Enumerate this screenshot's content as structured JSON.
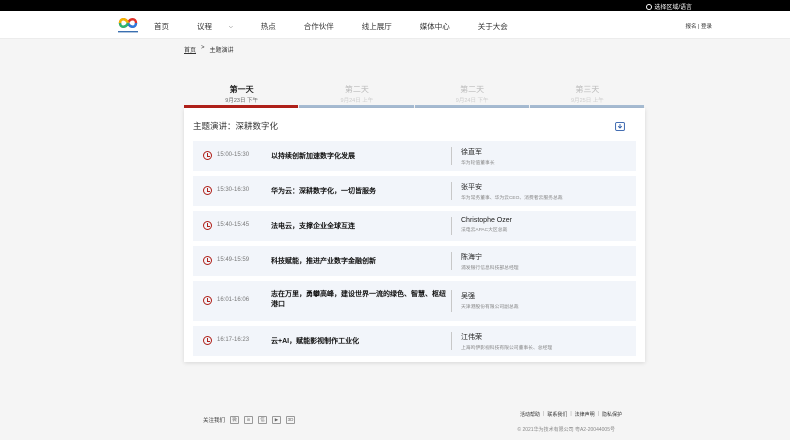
{
  "topbar": {
    "region_label": "选择区域/语言"
  },
  "header": {
    "nav": [
      {
        "label": "首页",
        "dropdown": false
      },
      {
        "label": "议程",
        "dropdown": true
      },
      {
        "label": "热点",
        "dropdown": false
      },
      {
        "label": "合作伙伴",
        "dropdown": false
      },
      {
        "label": "线上展厅",
        "dropdown": false
      },
      {
        "label": "媒体中心",
        "dropdown": false
      },
      {
        "label": "关于大会",
        "dropdown": false
      }
    ],
    "register": "报名",
    "login": "登录",
    "separator": "|"
  },
  "breadcrumb": {
    "home": "首页",
    "sep": ">",
    "current": "主题演讲"
  },
  "days": [
    {
      "name": "第一天",
      "date": "9月23日 下午",
      "active": true
    },
    {
      "name": "第二天",
      "date": "9月24日 上午",
      "active": false
    },
    {
      "name": "第二天",
      "date": "9月24日 下午",
      "active": false
    },
    {
      "name": "第三天",
      "date": "9月25日 上午",
      "active": false
    }
  ],
  "card": {
    "title": "主题演讲：深耕数字化",
    "sessions": [
      {
        "time": "15:00-15:30",
        "title": "以持续创新加速数字化发展",
        "speaker": "徐直军",
        "role": "华为轮值董事长",
        "tall": false
      },
      {
        "time": "15:30-16:30",
        "title": "华为云：深耕数字化，一切皆服务",
        "speaker": "张平安",
        "role": "华为常务董事、华为云CEO、消费者云服务总裁",
        "tall": false
      },
      {
        "time": "15:40-15:45",
        "title": "法电云，支撑企业全球互连",
        "speaker": "Christophe Ozer",
        "role": "法电云APAC大区总裁",
        "tall": false
      },
      {
        "time": "15:49-15:59",
        "title": "科技赋能，推进产业数字金融创新",
        "speaker": "陈海宁",
        "role": "浦发银行信息科技部总经理",
        "tall": false
      },
      {
        "time": "16:01-16:06",
        "title": "志在万里，勇攀高峰，建设世界一流的绿色、智慧、枢纽港口",
        "speaker": "吴强",
        "role": "天津港股份有限公司副总裁",
        "tall": true
      },
      {
        "time": "16:17-16:23",
        "title": "云+AI，赋能影视制作工业化",
        "speaker": "江伟荣",
        "role": "上海鸣伊影视科技有限公司董事长、总经理",
        "tall": false
      }
    ]
  },
  "footer": {
    "follow": "关注我们",
    "links": [
      "活动帮助",
      "联系我们",
      "法律声明",
      "隐私保护"
    ],
    "link_sep": "|",
    "copyright": "© 2021华为技术有限公司 粤A2-20044005号"
  },
  "colors": {
    "accent": "#b1211a",
    "inactive_bar": "#a7bcd3",
    "session_bg": "#f2f5fa"
  }
}
